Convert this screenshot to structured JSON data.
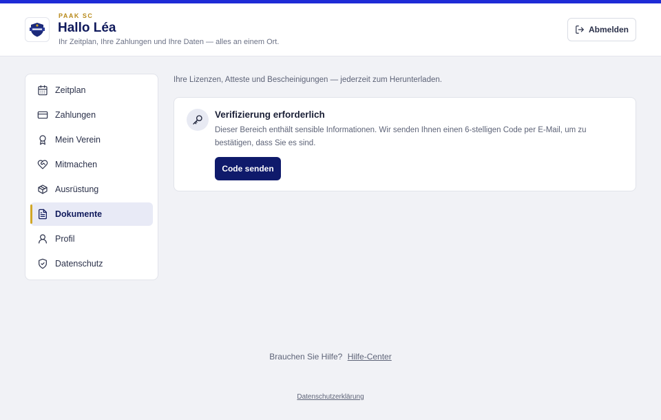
{
  "header": {
    "club": "PAAK SC",
    "greeting": "Hallo Léa",
    "subtitle": "Ihr Zeitplan, Ihre Zahlungen und Ihre Daten — alles an einem Ort.",
    "logout_label": "Abmelden"
  },
  "sidebar": {
    "items": [
      {
        "label": "Zeitplan",
        "icon": "calendar-icon"
      },
      {
        "label": "Zahlungen",
        "icon": "credit-card-icon"
      },
      {
        "label": "Mein Verein",
        "icon": "award-icon"
      },
      {
        "label": "Mitmachen",
        "icon": "heart-handshake-icon"
      },
      {
        "label": "Ausrüstung",
        "icon": "package-icon"
      },
      {
        "label": "Dokumente",
        "icon": "document-icon",
        "active": true
      },
      {
        "label": "Profil",
        "icon": "user-icon"
      },
      {
        "label": "Datenschutz",
        "icon": "shield-icon"
      }
    ]
  },
  "main": {
    "intro": "Ihre Lizenzen, Atteste und Bescheinigungen — jederzeit zum Herunterladen.",
    "card": {
      "title": "Verifizierung erforderlich",
      "text": "Dieser Bereich enthält sensible Informationen. Wir senden Ihnen einen 6-stelligen Code per E-Mail, um zu bestätigen, dass Sie es sind.",
      "button": "Code senden"
    }
  },
  "footer": {
    "help_prompt": "Brauchen Sie Hilfe?",
    "help_link": "Hilfe-Center",
    "privacy_link": "Datenschutzerklärung"
  },
  "colors": {
    "accent": "#1e2bd6",
    "primary": "#0f1a6b",
    "active_marker": "#d1a727",
    "club_label": "#b88a1a"
  }
}
